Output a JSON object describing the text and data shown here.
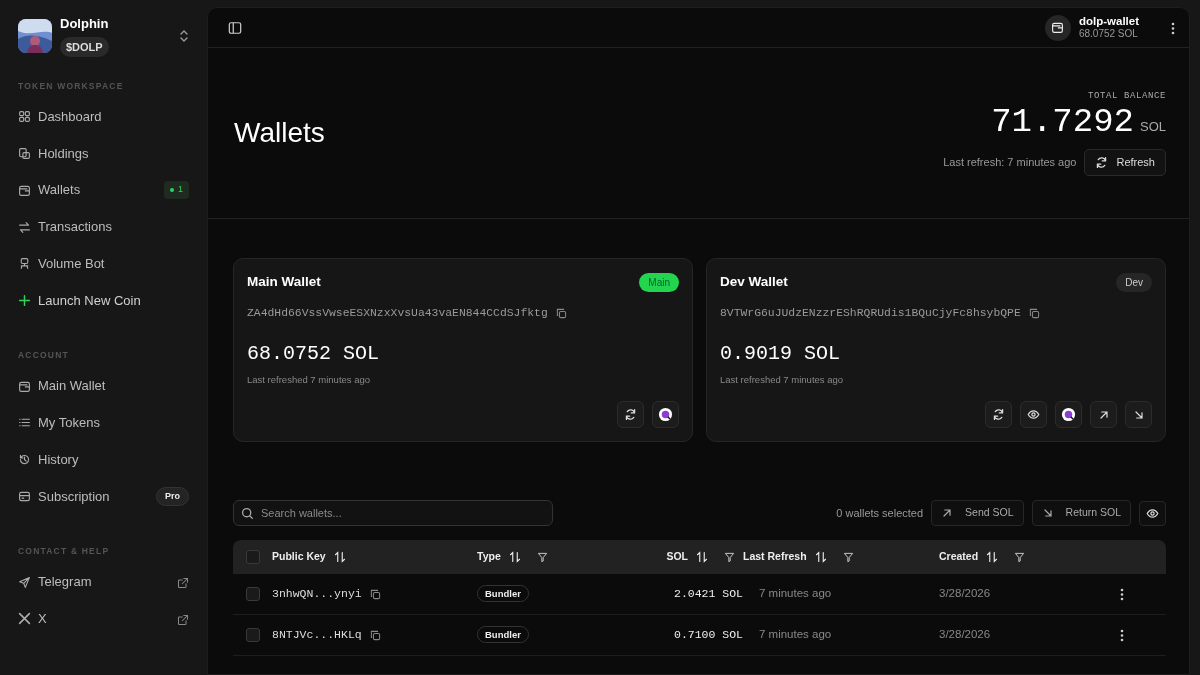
{
  "workspace": {
    "name": "Dolphin",
    "ticker": "$DOLP"
  },
  "sidebar": [
    {
      "title": "TOKEN WORKSPACE",
      "items": [
        {
          "label": "Dashboard",
          "kind": "link"
        },
        {
          "label": "Holdings",
          "kind": "link"
        },
        {
          "label": "Wallets",
          "kind": "link",
          "badge": "1"
        },
        {
          "label": "Transactions",
          "kind": "link"
        },
        {
          "label": "Volume Bot",
          "kind": "link"
        },
        {
          "label": "Launch New Coin",
          "kind": "action"
        }
      ]
    },
    {
      "title": "ACCOUNT",
      "items": [
        {
          "label": "Main Wallet",
          "kind": "link"
        },
        {
          "label": "My Tokens",
          "kind": "link"
        },
        {
          "label": "History",
          "kind": "link"
        },
        {
          "label": "Subscription",
          "kind": "link",
          "tag": "Pro"
        }
      ]
    },
    {
      "title": "CONTACT & HELP",
      "items": [
        {
          "label": "Telegram",
          "kind": "external"
        },
        {
          "label": "X",
          "kind": "external"
        }
      ]
    }
  ],
  "header": {
    "wallet_name": "dolp-wallet",
    "wallet_balance": "68.0752 SOL"
  },
  "page": {
    "title": "Wallets",
    "balance_label": "TOTAL BALANCE",
    "balance": "71.7292",
    "unit": "SOL",
    "last_refresh": "Last refresh: 7 minutes ago",
    "refresh_button": "Refresh"
  },
  "cards": [
    {
      "title": "Main Wallet",
      "tag": "Main",
      "color": "#23d44f",
      "address": "ZA4dHd66VssVwseESXNzxXvsUa43vaEN844CCdSJfktg",
      "balance": "68.0752 SOL",
      "refreshed": "Last refreshed 7 minutes ago",
      "actions": [
        {
          "kind": "refresh"
        },
        {
          "kind": "explorer"
        }
      ]
    },
    {
      "title": "Dev Wallet",
      "tag": "Dev",
      "color": "#262626",
      "address": "8VTWrG6uJUdzENzzrEShRQRUdis1BQuCjyFc8hsybQPE",
      "balance": "0.9019 SOL",
      "refreshed": "Last refreshed 7 minutes ago",
      "actions": [
        {
          "kind": "refresh"
        },
        {
          "kind": "view"
        },
        {
          "kind": "explorer"
        },
        {
          "kind": "send"
        },
        {
          "kind": "return"
        }
      ]
    }
  ],
  "toolbar": {
    "search_placeholder": "Search wallets...",
    "selected_count": "0 wallets selected",
    "send_button": "Send SOL",
    "return_button": "Return SOL"
  },
  "table": {
    "select_all_checked": false,
    "columns": [
      {
        "label": "Public Key",
        "filter": false
      },
      {
        "label": "Type",
        "filter": true
      },
      {
        "label": "SOL",
        "filter": true
      },
      {
        "label": "Last Refresh",
        "filter": true
      },
      {
        "label": "Created",
        "filter": true
      }
    ],
    "rows": [
      {
        "checked": false,
        "key": "3nhwQN...ynyi",
        "type": "Bundler",
        "sol": "2.0421 SOL",
        "refreshed": "7 minutes ago",
        "created": "3/28/2026"
      },
      {
        "checked": false,
        "key": "8NTJVc...HKLq",
        "type": "Bundler",
        "sol": "0.7100 SOL",
        "refreshed": "7 minutes ago",
        "created": "3/28/2026"
      }
    ]
  }
}
